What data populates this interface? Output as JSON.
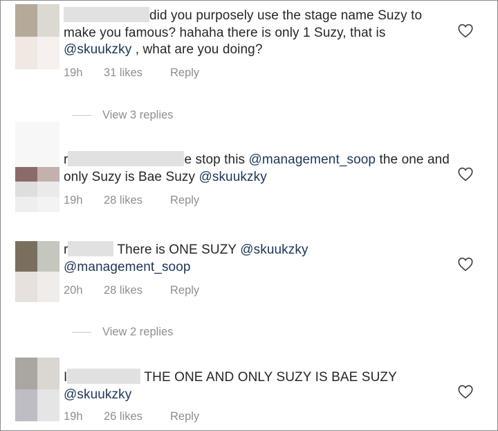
{
  "comments": [
    {
      "text_pre": "",
      "text_post": "did you purposely use the stage name Suzy to make you famous? hahaha there is only 1 Suzy, that is ",
      "mention1": "@skuukzky",
      "text_after": " , what are you doing?",
      "time": "19h",
      "likes": "31 likes",
      "reply": "Reply",
      "avatar_colors": [
        "#b5aa9a",
        "#dcd8d2",
        "#efe8e3",
        "#f6f1ee"
      ]
    },
    {
      "text_pre": "r",
      "text_post": "e stop this ",
      "mention1": "@management_soop",
      "text_mid": " the one and only Suzy is Bae Suzy ",
      "mention2": "@skuukzky",
      "time": "19h",
      "likes": "28 likes",
      "reply": "Reply",
      "avatar_colors": [
        "#8b6a6a",
        "#c4b0ad",
        "#dedede",
        "#eaeaea"
      ]
    },
    {
      "text_pre": "r",
      "text_post": " There is ONE SUZY ",
      "mention1": "@skuukzky",
      "mention2": "@management_soop",
      "time": "20h",
      "likes": "28 likes",
      "reply": "Reply",
      "avatar_colors": [
        "#7a6e5e",
        "#c3c7bd",
        "#e6e1dc",
        "#efecea"
      ]
    },
    {
      "text_pre": "I",
      "text_post": " THE ONE AND ONLY SUZY IS BAE SUZY ",
      "mention1": "@skuukzky",
      "time": "19h",
      "likes": "26 likes",
      "reply": "Reply",
      "avatar_colors": [
        "#aaa6a1",
        "#dad7d2",
        "#bdbdc3",
        "#e5e4e7"
      ]
    }
  ],
  "view_replies": [
    "View 3 replies",
    "View 2 replies"
  ]
}
